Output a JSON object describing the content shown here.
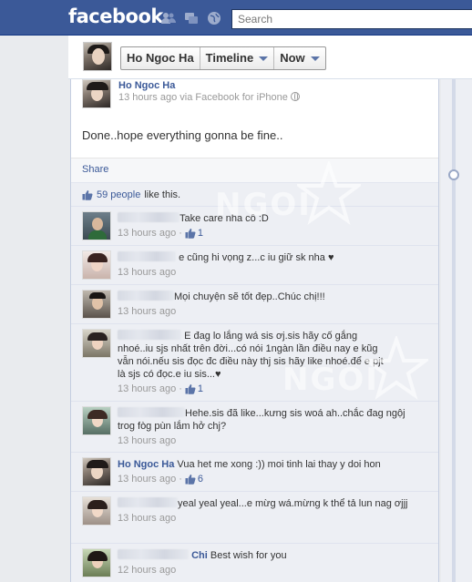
{
  "topbar": {
    "logo": "facebook",
    "search_placeholder": "Search",
    "jewels": [
      "friend-requests-icon",
      "messages-icon",
      "notifications-icon"
    ]
  },
  "timeline_header": {
    "name": "Ho Ngoc Ha",
    "timeline_label": "Timeline",
    "now_label": "Now"
  },
  "post": {
    "author": "Ho Ngoc Ha",
    "meta": "13 hours ago via Facebook for iPhone",
    "status": "Done..hope everything gonna be fine..",
    "share_label": "Share",
    "likes_count": "59 people",
    "likes_suffix": "like this."
  },
  "watermarks": [
    "NGOI",
    "NGOI"
  ],
  "comments": [
    {
      "name": "",
      "text": "Take care nha cô :D",
      "time": "13 hours ago",
      "likes": "1"
    },
    {
      "name": "",
      "text": "e cũng hi vọng z...c iu giữ sk nha ♥",
      "time": "13 hours ago",
      "likes": ""
    },
    {
      "name": "",
      "text": "Mọi chuyện sẽ tốt đẹp..Chúc chị!!!",
      "time": "13 hours ago",
      "likes": ""
    },
    {
      "name": "",
      "text": "E đag lo lắng wá sis ơj.sis hãy cố gắng nhoé..iu sjs nhất trên đời...có nói 1ngàn lần điều nay e kũg vẫn nói.nếu sis đọc đc điều này thj sis hãy like nhoé.để e pjt là sjs có đọc.e iu sis...♥",
      "time": "13 hours ago",
      "likes": "1"
    },
    {
      "name": "",
      "text": "Hehe.sis đã like...kưng sis woá ah..chắc đag ngộj trog fòg pùn lắm hở chj?",
      "time": "13 hours ago",
      "likes": ""
    },
    {
      "name": "Ho Ngoc Ha",
      "text": "Vua het me xong :)) moi tinh lai thay y doi hon",
      "time": "13 hours ago",
      "likes": "6"
    },
    {
      "name": "",
      "text": "yeal yeal yeal...e mừg wá.mừng k thể tả lun nag ơjjj",
      "time": "13 hours ago",
      "likes": ""
    },
    {
      "name": "Chi",
      "text": "Best wish for you",
      "time": "12 hours ago",
      "likes": ""
    }
  ]
}
